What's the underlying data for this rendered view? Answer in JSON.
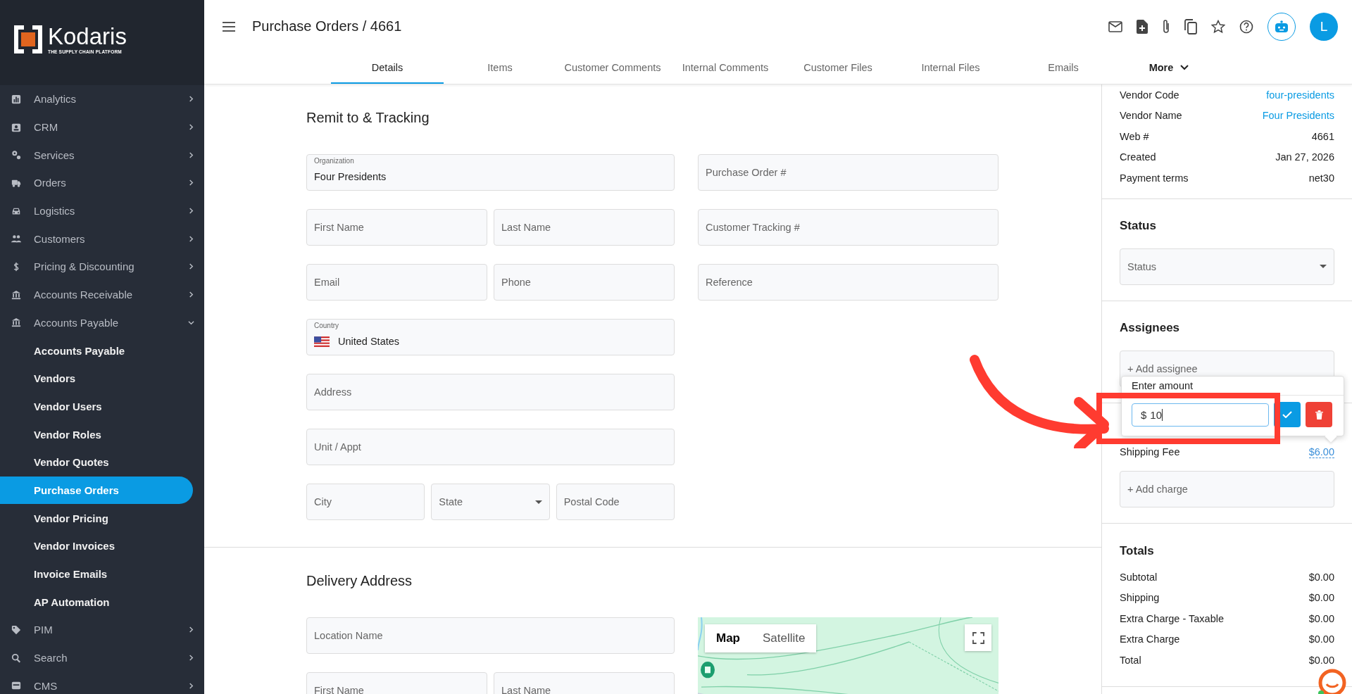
{
  "sidebar": {
    "brand": "Kodaris",
    "tagline": "THE SUPPLY CHAIN PLATFORM",
    "items": [
      {
        "label": "Analytics",
        "expanded": false
      },
      {
        "label": "CRM",
        "expanded": false
      },
      {
        "label": "Services",
        "expanded": false
      },
      {
        "label": "Orders",
        "expanded": false
      },
      {
        "label": "Logistics",
        "expanded": false
      },
      {
        "label": "Customers",
        "expanded": false
      },
      {
        "label": "Pricing & Discounting",
        "expanded": false
      },
      {
        "label": "Accounts Receivable",
        "expanded": false
      },
      {
        "label": "Accounts Payable",
        "expanded": true,
        "children": [
          {
            "label": "Accounts Payable",
            "selected": false
          },
          {
            "label": "Vendors",
            "selected": false
          },
          {
            "label": "Vendor Users",
            "selected": false
          },
          {
            "label": "Vendor Roles",
            "selected": false
          },
          {
            "label": "Vendor Quotes",
            "selected": false
          },
          {
            "label": "Purchase Orders",
            "selected": true
          },
          {
            "label": "Vendor Pricing",
            "selected": false
          },
          {
            "label": "Vendor Invoices",
            "selected": false
          },
          {
            "label": "Invoice Emails",
            "selected": false
          },
          {
            "label": "AP Automation",
            "selected": false
          }
        ]
      },
      {
        "label": "PIM",
        "expanded": false
      },
      {
        "label": "Search",
        "expanded": false
      },
      {
        "label": "CMS",
        "expanded": false
      }
    ]
  },
  "header": {
    "title": "Purchase Orders / 4661",
    "avatar": "L"
  },
  "tabs": [
    {
      "label": "Details",
      "selected": true,
      "kind": "tab"
    },
    {
      "label": "Items",
      "selected": false,
      "kind": "tab"
    },
    {
      "label": "Customer Comments",
      "selected": false,
      "kind": "tab"
    },
    {
      "label": "Internal Comments",
      "selected": false,
      "kind": "tab"
    },
    {
      "label": "Customer Files",
      "selected": false,
      "kind": "tab"
    },
    {
      "label": "Internal Files",
      "selected": false,
      "kind": "tab"
    },
    {
      "label": "Emails",
      "selected": false,
      "kind": "tab"
    },
    {
      "label": "More",
      "selected": false,
      "kind": "menu"
    }
  ],
  "sections": [
    {
      "title": "Remit to & Tracking",
      "left_rows": [
        [
          {
            "kind": "text",
            "label": "Organization",
            "value": "Four Presidents"
          }
        ],
        [
          {
            "kind": "text",
            "placeholder": "First Name"
          },
          {
            "kind": "text",
            "placeholder": "Last Name"
          }
        ],
        [
          {
            "kind": "text",
            "placeholder": "Email"
          },
          {
            "kind": "text",
            "placeholder": "Phone"
          }
        ],
        [
          {
            "kind": "country",
            "label": "Country",
            "value": "United States"
          }
        ],
        [
          {
            "kind": "text",
            "placeholder": "Address"
          }
        ],
        [
          {
            "kind": "text",
            "placeholder": "Unit / Appt"
          }
        ],
        [
          {
            "kind": "text",
            "placeholder": "City"
          },
          {
            "kind": "select",
            "placeholder": "State"
          },
          {
            "kind": "text",
            "placeholder": "Postal Code"
          }
        ]
      ],
      "right": {
        "kind": "fields",
        "fields": [
          {
            "placeholder": "Purchase Order #"
          },
          {
            "placeholder": "Customer Tracking #"
          },
          {
            "placeholder": "Reference"
          }
        ]
      }
    },
    {
      "title": "Delivery Address",
      "left_rows": [
        [
          {
            "kind": "text",
            "placeholder": "Location Name"
          }
        ],
        [
          {
            "kind": "text",
            "placeholder": "First Name"
          },
          {
            "kind": "text",
            "placeholder": "Last Name"
          }
        ]
      ],
      "right": {
        "kind": "map",
        "map_types": [
          {
            "label": "Map",
            "selected": true
          },
          {
            "label": "Satellite",
            "selected": false
          }
        ]
      }
    }
  ],
  "details": [
    {
      "label": "Vendor Code",
      "value": "four-presidents",
      "link": true
    },
    {
      "label": "Vendor Name",
      "value": "Four Presidents",
      "link": true
    },
    {
      "label": "Web #",
      "value": "4661",
      "link": false
    },
    {
      "label": "Created",
      "value": "Jan 27, 2026",
      "link": false
    },
    {
      "label": "Payment terms",
      "value": "net30",
      "link": false
    }
  ],
  "status": {
    "title": "Status",
    "placeholder": "Status"
  },
  "assignees": {
    "title": "Assignees",
    "add": "+ Add assignee"
  },
  "amount_popup": {
    "title": "Enter amount",
    "prefix": "$",
    "value": "10"
  },
  "charges": {
    "items": [
      {
        "label": "Shipping Fee",
        "value": "$6.00"
      }
    ],
    "add": "+ Add charge"
  },
  "totals": {
    "title": "Totals",
    "rows": [
      {
        "label": "Subtotal",
        "value": "$0.00"
      },
      {
        "label": "Shipping",
        "value": "$0.00"
      },
      {
        "label": "Extra Charge - Taxable",
        "value": "$0.00"
      },
      {
        "label": "Extra Charge",
        "value": "$0.00"
      },
      {
        "label": "Total",
        "value": "$0.00"
      }
    ]
  }
}
